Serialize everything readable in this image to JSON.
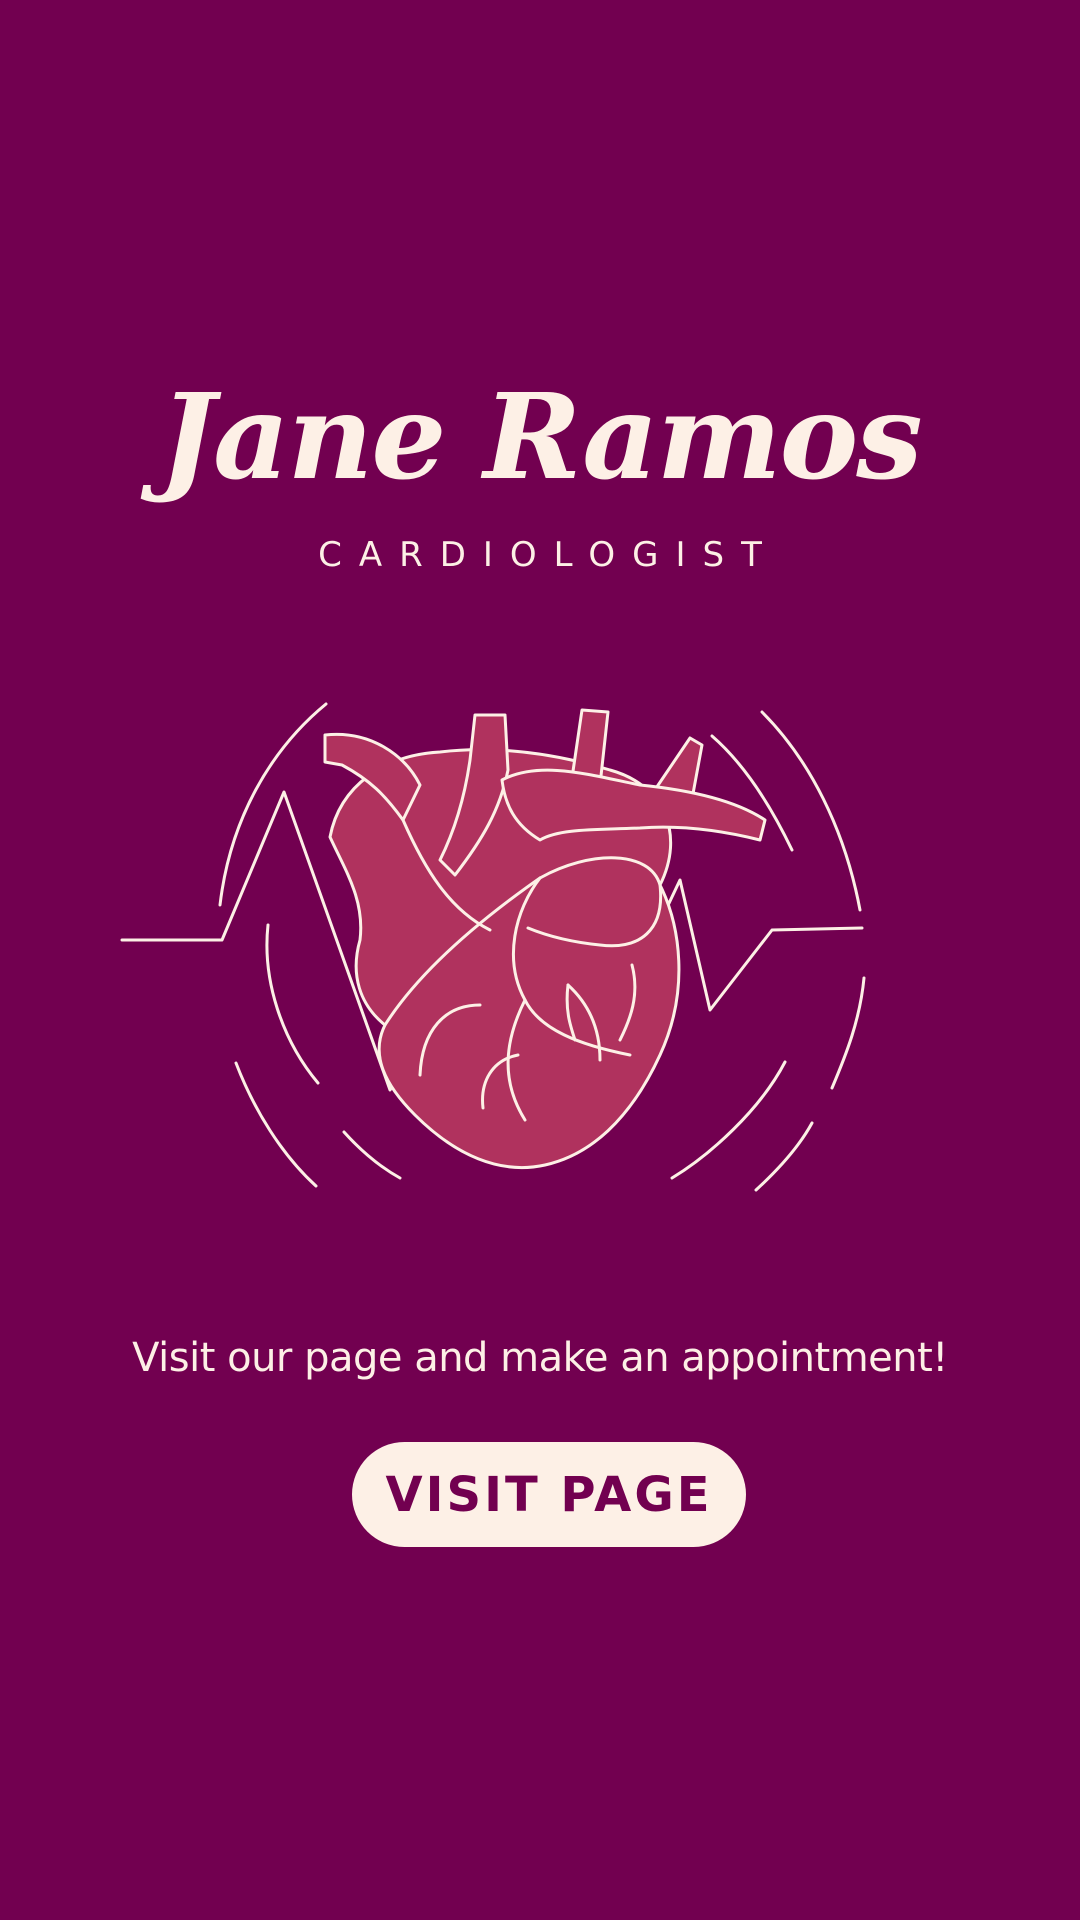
{
  "profile": {
    "name": "Jane Ramos",
    "title": "CARDIOLOGIST"
  },
  "illustration": {
    "icon": "anatomical-heart-icon",
    "heart_color": "#b0325e",
    "line_color": "#fdf0e6"
  },
  "promo": {
    "tagline": "Visit our page and make an appointment!",
    "button_label": "VISIT PAGE"
  },
  "colors": {
    "background": "#720050",
    "text": "#fdf0e6",
    "button_background": "#fdf0e6",
    "button_text": "#720050"
  }
}
